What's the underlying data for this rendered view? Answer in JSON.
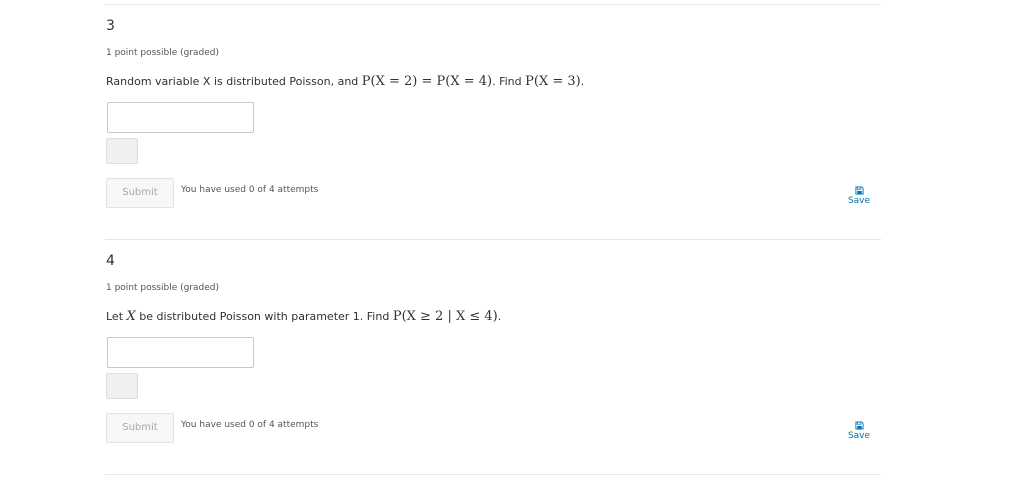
{
  "problems": [
    {
      "number": "3",
      "meta": "1 point possible (graded)",
      "text_prefix": "Random variable X is distributed Poisson, and ",
      "formula_1": "P(X = 2) = P(X = 4)",
      "text_mid": ". Find ",
      "formula_2": "P(X = 3)",
      "text_suffix": ".",
      "answer_value": "",
      "submit_label": "Submit",
      "attempts_text": "You have used 0 of 4 attempts",
      "save_label": "Save"
    },
    {
      "number": "4",
      "meta": "1 point possible (graded)",
      "text_prefix": "Let ",
      "formula_var": "X",
      "text_mid": " be distributed Poisson with parameter 1. Find ",
      "formula_2": "P(X ≥ 2 | X ≤ 4)",
      "text_suffix": ".",
      "answer_value": "",
      "submit_label": "Submit",
      "attempts_text": "You have used 0 of 4 attempts",
      "save_label": "Save"
    }
  ],
  "icons": {
    "save": "floppy-disk-icon"
  },
  "colors": {
    "link": "#0075b4",
    "rule": "#e6e6e6",
    "submit_disabled_text": "#a8a8a8"
  }
}
